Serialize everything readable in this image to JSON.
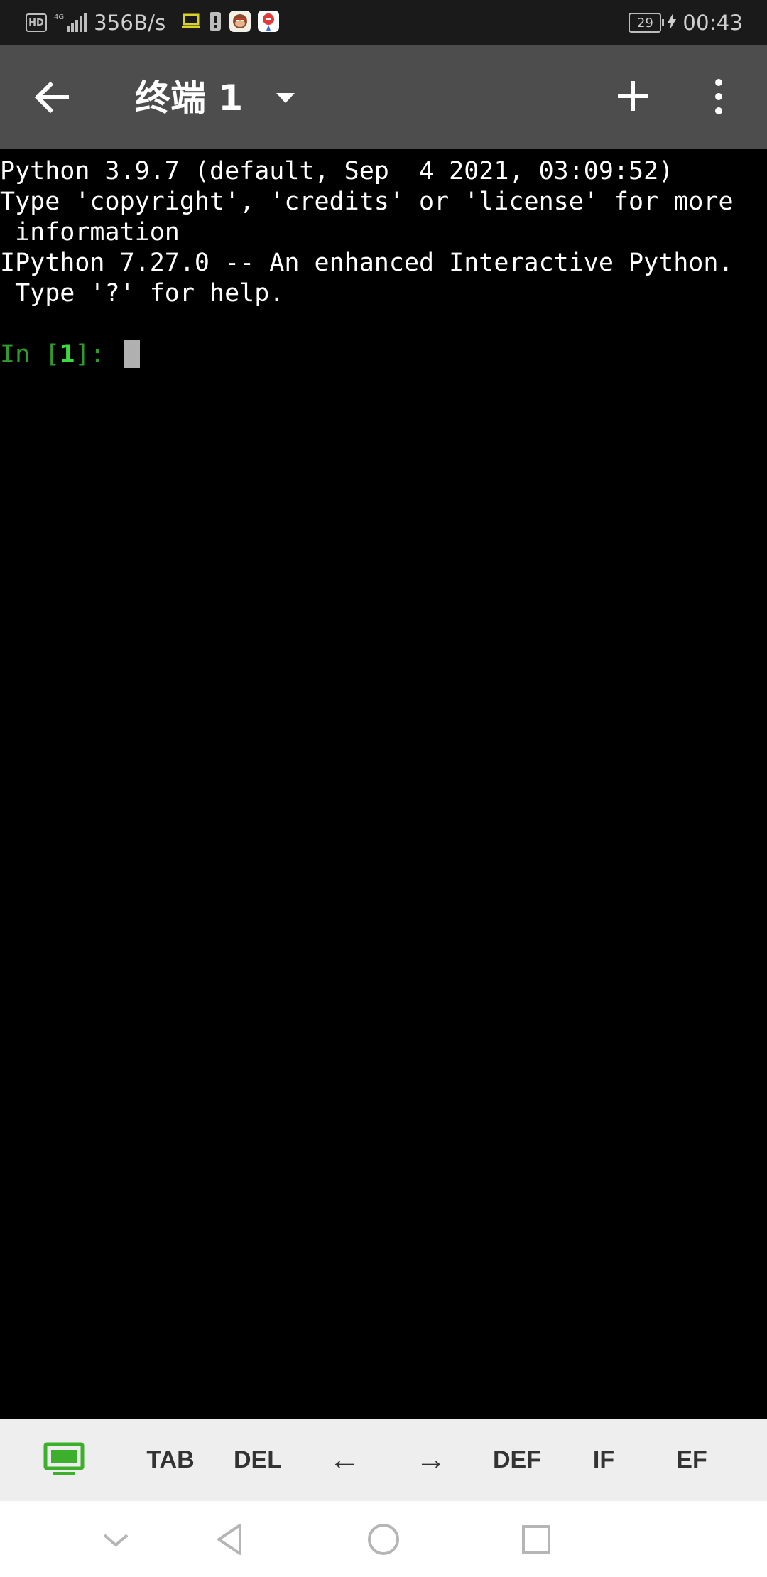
{
  "status_bar": {
    "hd_label": "HD",
    "network_type": "4G",
    "net_speed": "356B/s",
    "battery_level": "29",
    "time": "00:43"
  },
  "app_bar": {
    "title": "终端 1",
    "icons": [
      "back-arrow-icon",
      "dropdown-arrow-icon",
      "add-icon",
      "more-vert-icon"
    ]
  },
  "terminal": {
    "lines": [
      "Python 3.9.7 (default, Sep  4 2021, 03:09:52)",
      "Type 'copyright', 'credits' or 'license' for more",
      " information",
      "IPython 7.27.0 -- An enhanced Interactive Python.",
      " Type '?' for help."
    ],
    "prompt_prefix": "In [",
    "prompt_number": "1",
    "prompt_suffix": "]: "
  },
  "extra_keys": {
    "keys": [
      "TAB",
      "DEL",
      "←",
      "→",
      "DEF",
      "IF",
      "EF"
    ],
    "keyboard_toggle_icon": "keyboard-toggle-icon",
    "accent_color": "#3cb02c"
  },
  "nav_bar": {
    "icons": [
      "hide-keyboard-icon",
      "back-triangle-icon",
      "home-circle-icon",
      "recents-square-icon"
    ]
  }
}
